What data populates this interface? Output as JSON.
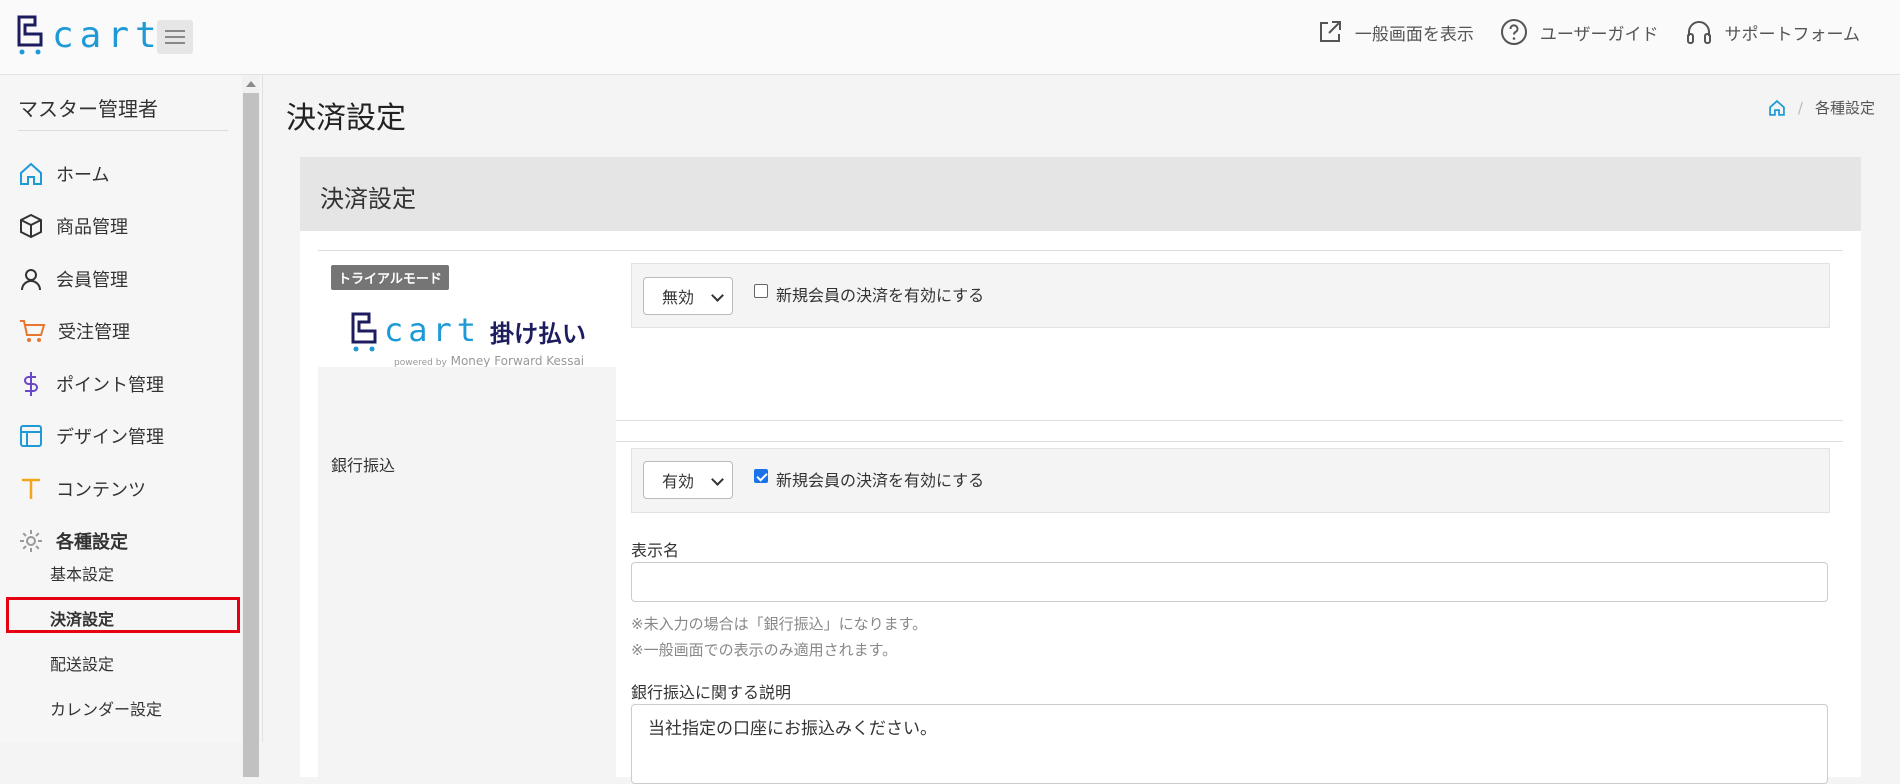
{
  "topbar": {
    "logo_text": "cart",
    "nav": [
      {
        "label": "一般画面を表示",
        "icon": "external-link-icon"
      },
      {
        "label": "ユーザーガイド",
        "icon": "help-circle-icon"
      },
      {
        "label": "サポートフォーム",
        "icon": "headphones-icon"
      }
    ]
  },
  "sidebar": {
    "title": "マスター管理者",
    "items": [
      {
        "label": "ホーム",
        "icon": "home-icon"
      },
      {
        "label": "商品管理",
        "icon": "box-icon"
      },
      {
        "label": "会員管理",
        "icon": "user-icon"
      },
      {
        "label": "受注管理",
        "icon": "cart-icon"
      },
      {
        "label": "ポイント管理",
        "icon": "dollar-icon"
      },
      {
        "label": "デザイン管理",
        "icon": "layout-icon"
      },
      {
        "label": "コンテンツ",
        "icon": "text-icon"
      },
      {
        "label": "各種設定",
        "icon": "gear-icon"
      }
    ],
    "sub_items": [
      {
        "label": "基本設定"
      },
      {
        "label": "決済設定",
        "active": true
      },
      {
        "label": "配送設定"
      },
      {
        "label": "カレンダー設定"
      }
    ]
  },
  "main": {
    "page_title": "決済設定",
    "breadcrumb": {
      "current": "各種設定"
    },
    "card_title": "決済設定",
    "trial_badge": "トライアルモード",
    "kakebarai": {
      "logo_text": "cart",
      "logo_suffix": "掛け払い",
      "powered_by": "powered by",
      "powered_name": "Money Forward Kessai",
      "select_value": "無効",
      "new_member_label": "新規会員の決済を有効にする",
      "new_member_checked": false
    },
    "bank": {
      "row_label": "銀行振込",
      "select_value": "有効",
      "new_member_label": "新規会員の決済を有効にする",
      "new_member_checked": true,
      "display_name_label": "表示名",
      "display_name_value": "",
      "help1": "※未入力の場合は「銀行振込」になります。",
      "help2": "※一般画面での表示のみ適用されます。",
      "description_label": "銀行振込に関する説明",
      "description_value": "当社指定の口座にお振込みください。"
    }
  },
  "colors": {
    "accent": "#1e9ad6",
    "active_box": "#e60012",
    "badge": "#757575",
    "checkbox": "#1a73e8"
  }
}
